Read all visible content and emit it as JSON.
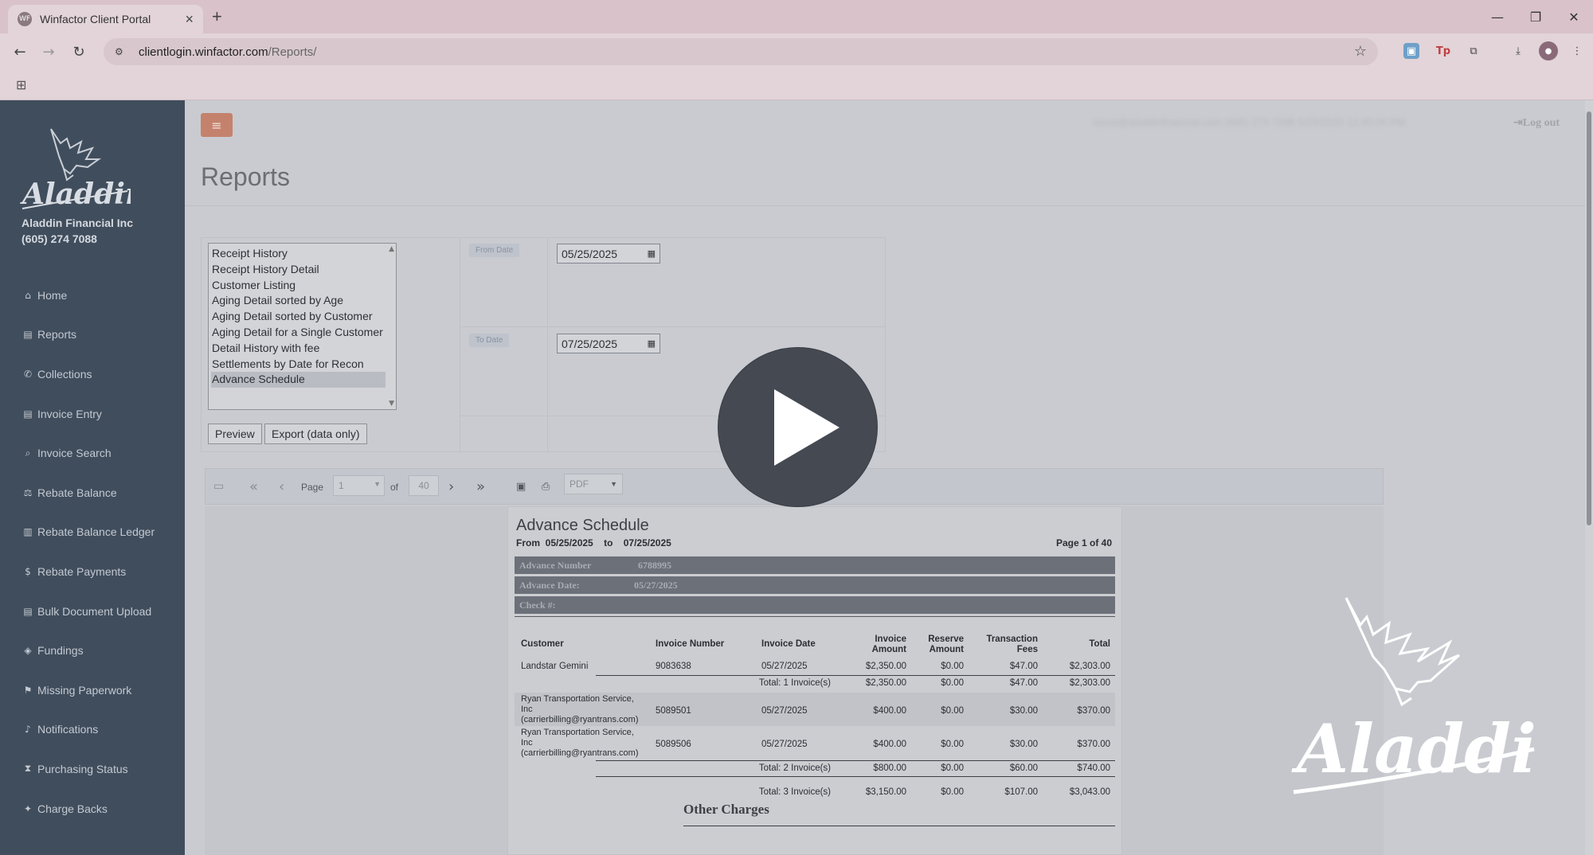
{
  "browser": {
    "tab_title": "Winfactor Client Portal",
    "favicon_text": "WF",
    "url_host": "clientlogin.winfactor.com",
    "url_path": "/Reports/",
    "window_controls": [
      "—",
      "❐",
      "✕"
    ]
  },
  "sidebar": {
    "company_name": "Aladdin Financial Inc",
    "phone": "(605) 274 7088",
    "logo_text": "Aladdin",
    "items": [
      {
        "label": "Home",
        "icon": "home-icon",
        "glyph": "⌂"
      },
      {
        "label": "Reports",
        "icon": "file-icon",
        "glyph": "▤"
      },
      {
        "label": "Collections",
        "icon": "phone-icon",
        "glyph": "✆"
      },
      {
        "label": "Invoice Entry",
        "icon": "file-icon",
        "glyph": "▤"
      },
      {
        "label": "Invoice Search",
        "icon": "search-icon",
        "glyph": "⌕"
      },
      {
        "label": "Rebate Balance",
        "icon": "balance-scale-icon",
        "glyph": "⚖"
      },
      {
        "label": "Rebate Balance Ledger",
        "icon": "book-icon",
        "glyph": "▥"
      },
      {
        "label": "Rebate Payments",
        "icon": "dollar-icon",
        "glyph": "$"
      },
      {
        "label": "Bulk Document Upload",
        "icon": "file-icon",
        "glyph": "▤"
      },
      {
        "label": "Fundings",
        "icon": "money-icon",
        "glyph": "◈"
      },
      {
        "label": "Missing Paperwork",
        "icon": "flag-icon",
        "glyph": "⚑"
      },
      {
        "label": "Notifications",
        "icon": "bell-icon",
        "glyph": "♪"
      },
      {
        "label": "Purchasing Status",
        "icon": "hourglass-icon",
        "glyph": "⧗"
      },
      {
        "label": "Charge Backs",
        "icon": "pin-icon",
        "glyph": "✦"
      }
    ]
  },
  "header": {
    "menu_glyph": "≡",
    "user_info": "steve@aladdinfinancial.com  (605) 274 7088  5/25/2025 12:45:00 PM",
    "logout": "Log out"
  },
  "page": {
    "title": "Reports"
  },
  "params": {
    "reports": [
      "Receipt History",
      "Receipt History Detail",
      "Customer Listing",
      "Aging Detail sorted by Age",
      "Aging Detail sorted by Customer",
      "Aging Detail for a Single Customer",
      "Detail History with fee",
      "Settlements by Date for Recon",
      "Advance Schedule"
    ],
    "selected_report": "Advance Schedule",
    "from_label": "From Date",
    "from_value": "05/25/2025",
    "to_label": "To Date",
    "to_value": "07/25/2025",
    "preview_label": "Preview",
    "export_label": "Export (data only)"
  },
  "viewer": {
    "page_label": "Page",
    "page_value": "1",
    "of_label": "of",
    "total_pages": "40",
    "format": "PDF"
  },
  "report": {
    "title": "Advance Schedule",
    "from_label": "From",
    "from": "05/25/2025",
    "to_label": "to",
    "to": "07/25/2025",
    "page_of": "Page 1 of 40",
    "advance_number_label": "Advance Number",
    "advance_number": "6788995",
    "advance_date_label": "Advance Date:",
    "advance_date": "05/27/2025",
    "check_label": "Check #:",
    "columns": [
      "Customer",
      "Invoice Number",
      "Invoice Date",
      "Invoice\nAmount",
      "Reserve\nAmount",
      "Transaction\nFees",
      "Total"
    ],
    "rows": [
      {
        "customer": "Landstar Gemini",
        "invoice": "9083638",
        "date": "05/27/2025",
        "amount": "$2,350.00",
        "reserve": "$0.00",
        "fees": "$47.00",
        "total": "$2,303.00"
      },
      {
        "customer": "Ryan Transportation Service,\nInc\n(carrierbilling@ryantrans.com)",
        "invoice": "5089501",
        "date": "05/27/2025",
        "amount": "$400.00",
        "reserve": "$0.00",
        "fees": "$30.00",
        "total": "$370.00"
      },
      {
        "customer": "Ryan Transportation Service,\nInc\n(carrierbilling@ryantrans.com)",
        "invoice": "5089506",
        "date": "05/27/2025",
        "amount": "$400.00",
        "reserve": "$0.00",
        "fees": "$30.00",
        "total": "$370.00"
      }
    ],
    "subtotal1": {
      "label": "Total: 1 Invoice(s)",
      "amount": "$2,350.00",
      "reserve": "$0.00",
      "fees": "$47.00",
      "total": "$2,303.00"
    },
    "subtotal2": {
      "label": "Total: 2 Invoice(s)",
      "amount": "$800.00",
      "reserve": "$0.00",
      "fees": "$60.00",
      "total": "$740.00"
    },
    "grand_total": {
      "label": "Total: 3 Invoice(s)",
      "amount": "$3,150.00",
      "reserve": "$0.00",
      "fees": "$107.00",
      "total": "$3,043.00"
    },
    "other_charges": "Other Charges"
  },
  "overlay": {
    "watermark_text": "Aladdin"
  }
}
